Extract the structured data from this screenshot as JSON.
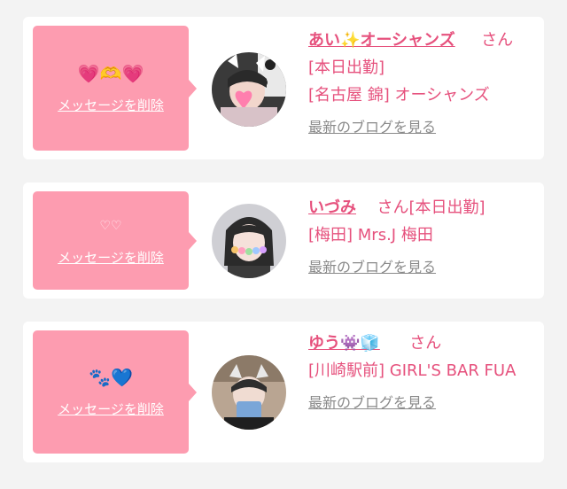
{
  "messages": [
    {
      "emoji": "💗🫶💗",
      "delete_label": "メッセージを削除",
      "avatar_icon": "girl-photo-heart-sticker",
      "name": "あい✨オーシャンズ",
      "honorific": "さん",
      "status": "[本日出勤]",
      "shop": "[名古屋 錦] オーシャンズ",
      "blog_link": "最新のブログを見る"
    },
    {
      "emoji": "♡♡",
      "delete_label": "メッセージを削除",
      "avatar_icon": "girl-photo-heart-sticker",
      "name": "いづみ",
      "honorific": "さん",
      "status": "[本日出勤]",
      "shop": "[梅田] Mrs.J 梅田",
      "blog_link": "最新のブログを見る"
    },
    {
      "emoji": "🐾💙",
      "delete_label": "メッセージを削除",
      "avatar_icon": "girl-photo-cat-ears",
      "name": "ゆう👾🧊",
      "honorific": "さん",
      "status": "",
      "shop": "[川崎駅前] GIRL'S BAR FUA",
      "blog_link": "最新のブログを見る"
    }
  ]
}
